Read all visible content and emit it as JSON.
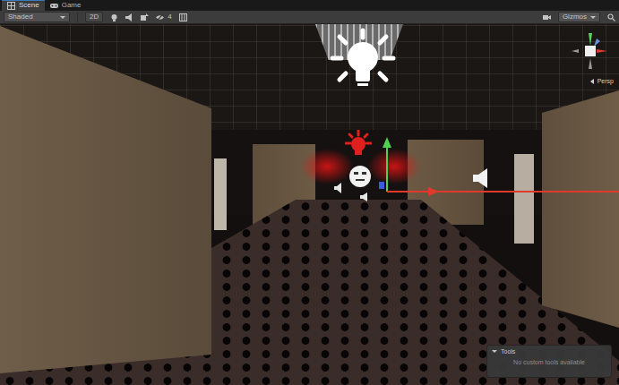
{
  "tabs": [
    {
      "label": "Scene",
      "selected": true
    },
    {
      "label": "Game",
      "selected": false
    }
  ],
  "toolbar": {
    "draw_mode": "Shaded",
    "mode_2d": {
      "label": "2D",
      "selected": false
    },
    "visibility_count": "4",
    "gizmos": "Gizmos"
  },
  "orientation": {
    "label": "Persp"
  },
  "tools_overlay": {
    "title": "Tools",
    "message": "No custom tools available"
  }
}
